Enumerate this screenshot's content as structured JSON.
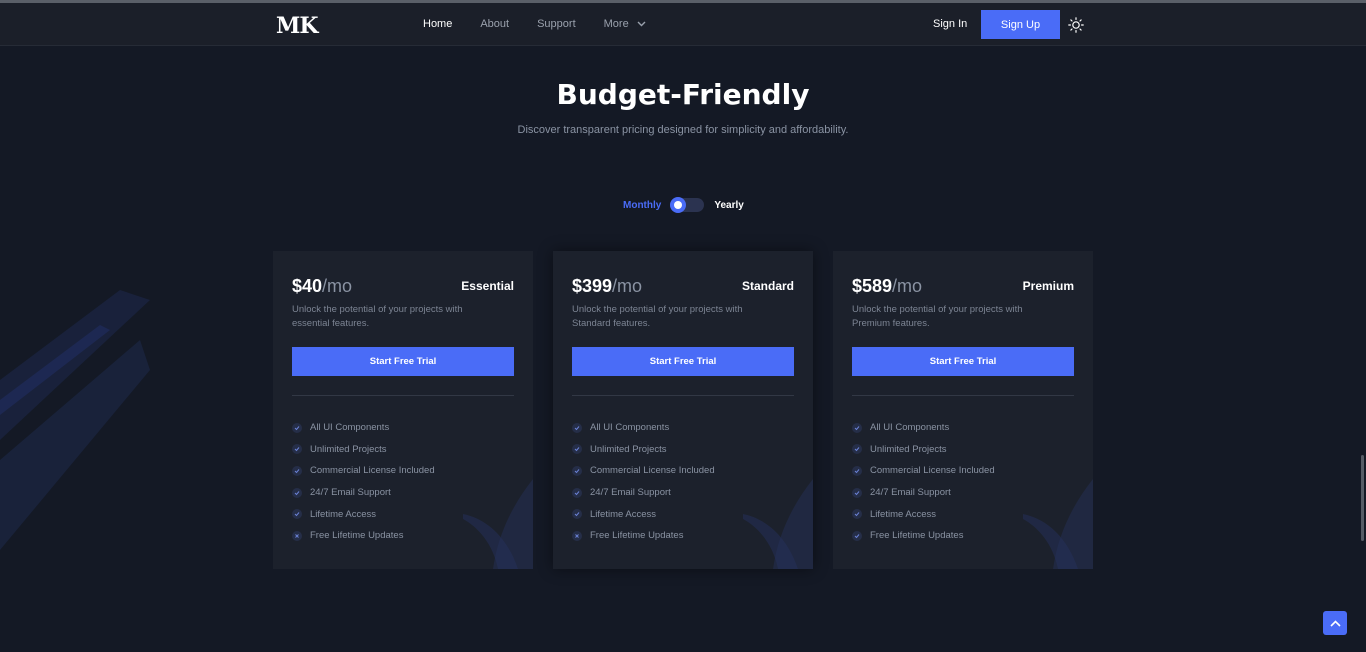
{
  "header": {
    "logo": "MK",
    "nav": [
      "Home",
      "About",
      "Support"
    ],
    "more_label": "More",
    "sign_in": "Sign In",
    "sign_up": "Sign Up"
  },
  "hero": {
    "title": "Budget-Friendly",
    "subtitle": "Discover transparent pricing designed for simplicity and affordability."
  },
  "billing_toggle": {
    "monthly": "Monthly",
    "yearly": "Yearly",
    "selected": "Monthly"
  },
  "plans": [
    {
      "price": "$40",
      "period": "/mo",
      "name": "Essential",
      "description": "Unlock the potential of your projects with essential features.",
      "cta": "Start Free Trial",
      "features": [
        {
          "label": "All UI Components",
          "included": true
        },
        {
          "label": "Unlimited Projects",
          "included": true
        },
        {
          "label": "Commercial License Included",
          "included": true
        },
        {
          "label": "24/7 Email Support",
          "included": true
        },
        {
          "label": "Lifetime Access",
          "included": true
        },
        {
          "label": "Free Lifetime Updates",
          "included": false
        }
      ]
    },
    {
      "price": "$399",
      "period": "/mo",
      "name": "Standard",
      "description": "Unlock the potential of your projects with Standard features.",
      "cta": "Start Free Trial",
      "features": [
        {
          "label": "All UI Components",
          "included": true
        },
        {
          "label": "Unlimited Projects",
          "included": true
        },
        {
          "label": "Commercial License Included",
          "included": true
        },
        {
          "label": "24/7 Email Support",
          "included": true
        },
        {
          "label": "Lifetime Access",
          "included": true
        },
        {
          "label": "Free Lifetime Updates",
          "included": false
        }
      ]
    },
    {
      "price": "$589",
      "period": "/mo",
      "name": "Premium",
      "description": "Unlock the potential of your projects with Premium features.",
      "cta": "Start Free Trial",
      "features": [
        {
          "label": "All UI Components",
          "included": true
        },
        {
          "label": "Unlimited Projects",
          "included": true
        },
        {
          "label": "Commercial License Included",
          "included": true
        },
        {
          "label": "24/7 Email Support",
          "included": true
        },
        {
          "label": "Lifetime Access",
          "included": true
        },
        {
          "label": "Free Lifetime Updates",
          "included": true
        }
      ]
    }
  ],
  "icons": {
    "theme_toggle": "sun-icon",
    "more": "chevron-down-icon",
    "included": "check-icon",
    "excluded": "x-icon",
    "scroll_top": "arrow-up-icon"
  },
  "colors": {
    "accent": "#4a6cf7",
    "background": "#141925",
    "card": "#1c212c",
    "header": "#1b1f29"
  }
}
